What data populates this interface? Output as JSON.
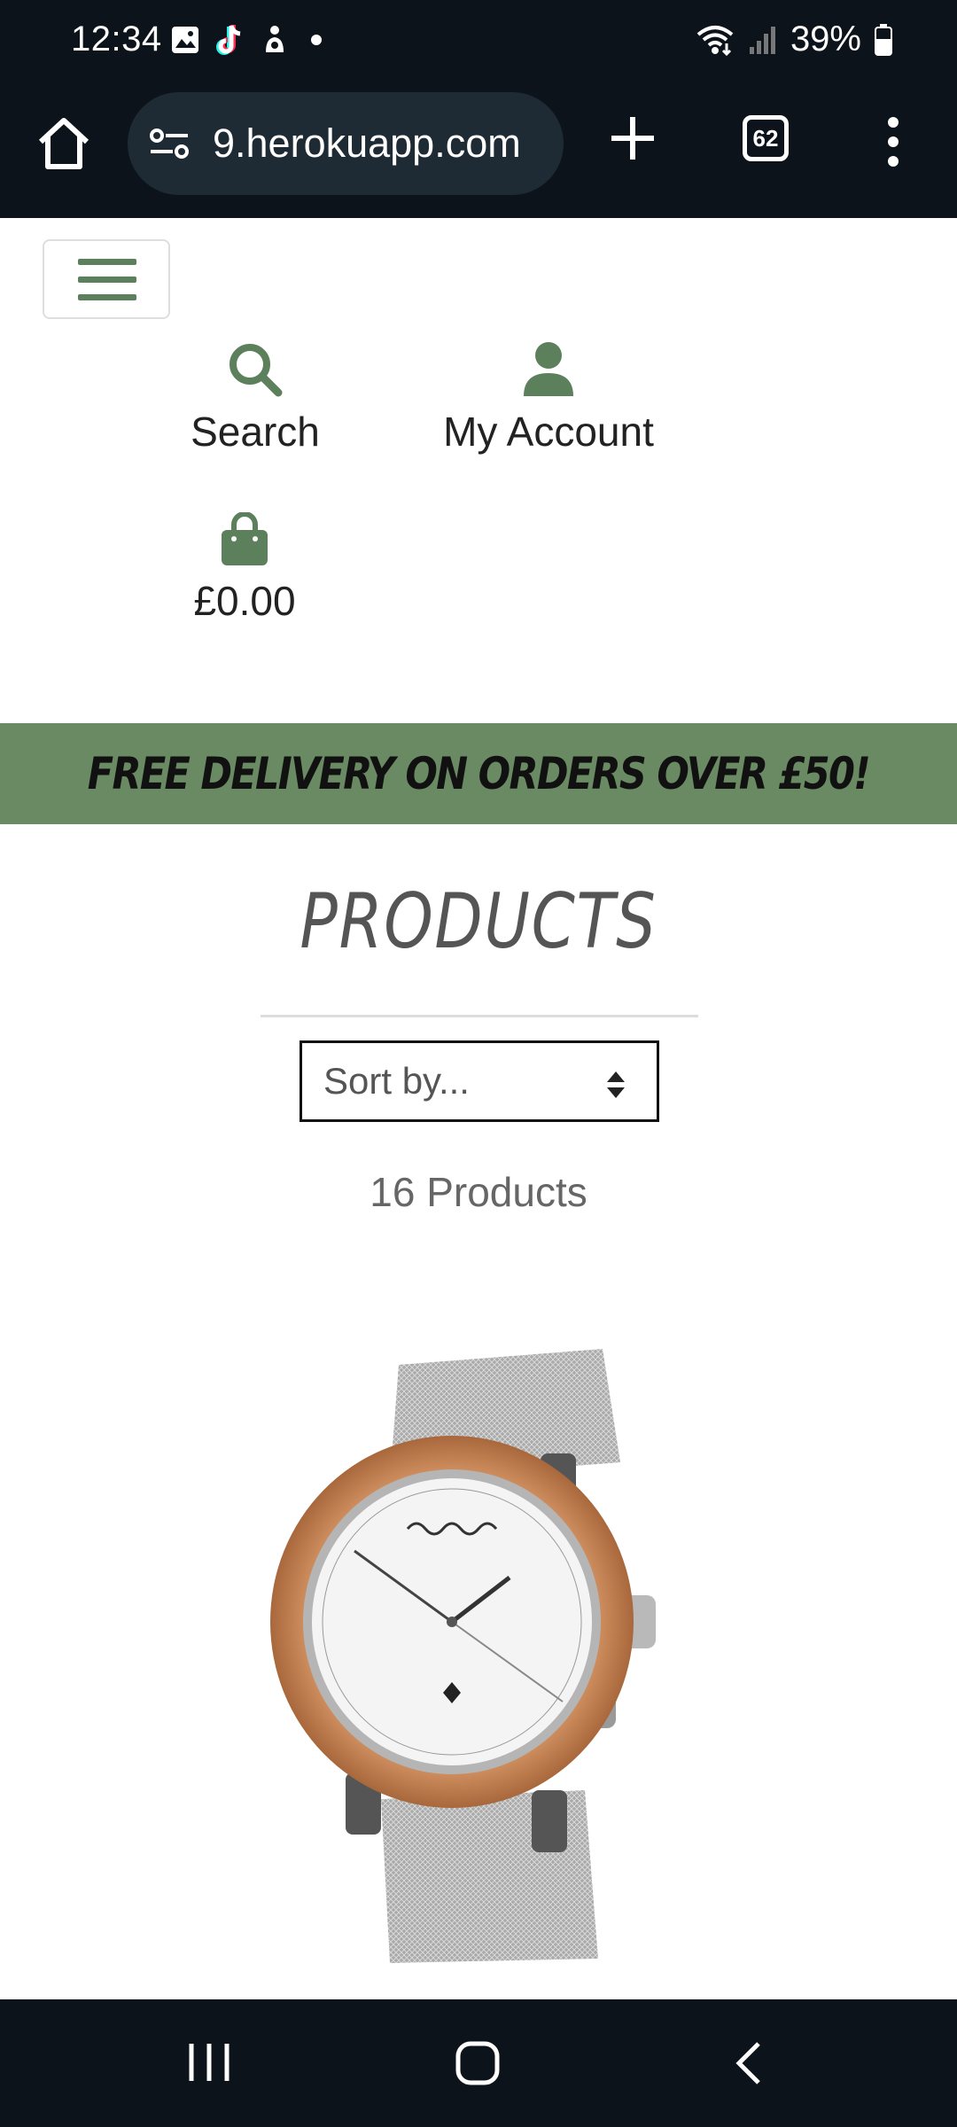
{
  "status_bar": {
    "time": "12:34",
    "battery": "39%",
    "left_icons": [
      "gallery-icon",
      "tiktok-icon",
      "app-notification-icon",
      "dot-icon"
    ],
    "right_icons": [
      "wifi-icon",
      "signal-icon",
      "battery-icon"
    ]
  },
  "browser": {
    "url": "9.herokuapp.com",
    "tab_count": "62"
  },
  "header": {
    "search_label": "Search",
    "account_label": "My Account",
    "bag_total": "£0.00",
    "accent_color": "#5c7f5c"
  },
  "promo": {
    "text": "FREE DELIVERY ON ORDERS OVER £50!",
    "background": "#6a8a63"
  },
  "products": {
    "title": "PRODUCTS",
    "sort_placeholder": "Sort by...",
    "count_text": "16 Products"
  },
  "system_nav": {
    "buttons": [
      "recents-button",
      "home-button",
      "back-button"
    ]
  }
}
